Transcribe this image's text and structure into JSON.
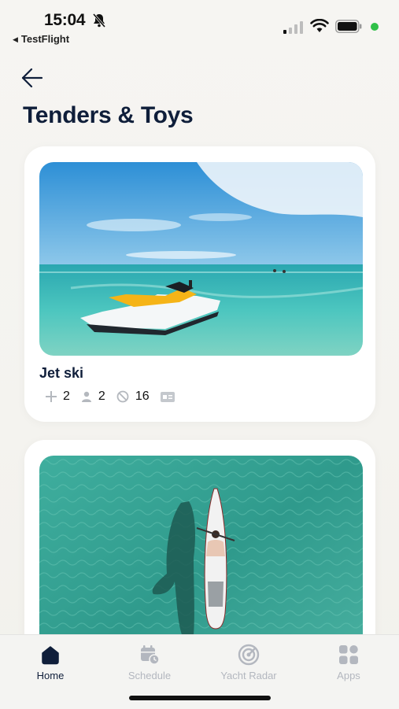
{
  "status_bar": {
    "time": "15:04",
    "back_app": "TestFlight",
    "icons": [
      "bell-slash-icon",
      "cellular-signal-icon",
      "wifi-icon",
      "battery-icon",
      "green-dot-indicator"
    ]
  },
  "page": {
    "title": "Tenders & Toys"
  },
  "items": [
    {
      "name": "Jet ski",
      "specs": [
        {
          "icon": "plus-icon",
          "value": "2"
        },
        {
          "icon": "person-icon",
          "value": "2"
        },
        {
          "icon": "no-entry-icon",
          "value": "16"
        },
        {
          "icon": "id-card-icon",
          "value": ""
        }
      ]
    },
    {
      "name": "",
      "image": "paddleboard-aerial-photo"
    }
  ],
  "tab_bar": {
    "tabs": [
      {
        "label": "Home",
        "icon": "home-icon",
        "active": true
      },
      {
        "label": "Schedule",
        "icon": "calendar-clock-icon",
        "active": false
      },
      {
        "label": "Yacht Radar",
        "icon": "radar-icon",
        "active": false
      },
      {
        "label": "Apps",
        "icon": "apps-grid-icon",
        "active": false
      }
    ]
  },
  "colors": {
    "primary_text": "#0f1e3a",
    "inactive_tab": "#b3b7bf",
    "status_dot": "#30c048"
  }
}
